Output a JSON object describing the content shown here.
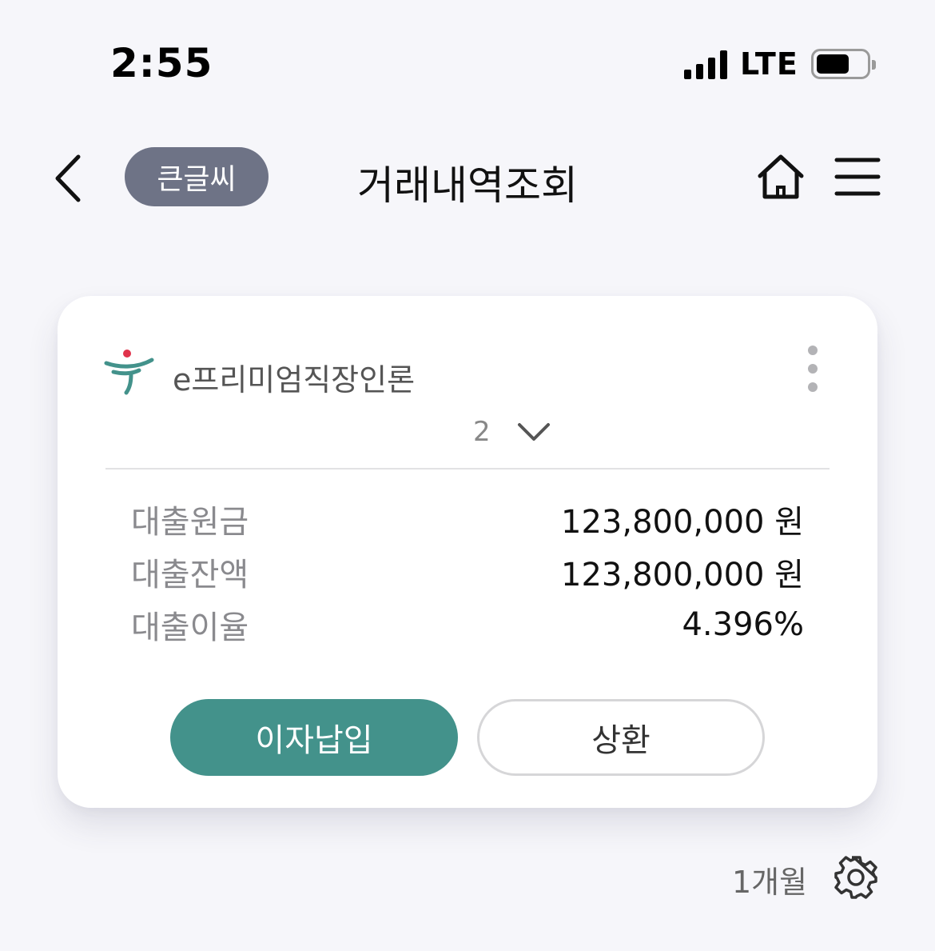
{
  "status_bar": {
    "time": "2:55",
    "network": "LTE"
  },
  "header": {
    "back_icon": "chevron-left-icon",
    "font_size_button": "큰글씨",
    "title": "거래내역조회",
    "home_icon": "home-icon",
    "menu_icon": "hamburger-menu-icon"
  },
  "loan_card": {
    "product_name": "e프리미엄직장인론",
    "account_partial": "2",
    "rows": [
      {
        "label": "대출원금",
        "value": "123,800,000 원"
      },
      {
        "label": "대출잔액",
        "value": "123,800,000 원"
      },
      {
        "label": "대출이율",
        "value": "4.396%"
      }
    ],
    "pay_interest_button": "이자납입",
    "repay_button": "상환"
  },
  "footer": {
    "period": "1개월",
    "settings_icon": "gear-icon"
  },
  "colors": {
    "background": "#f6f6fa",
    "accent": "#43928b",
    "pill_button": "#6e7386",
    "logo_red": "#e0334b"
  }
}
